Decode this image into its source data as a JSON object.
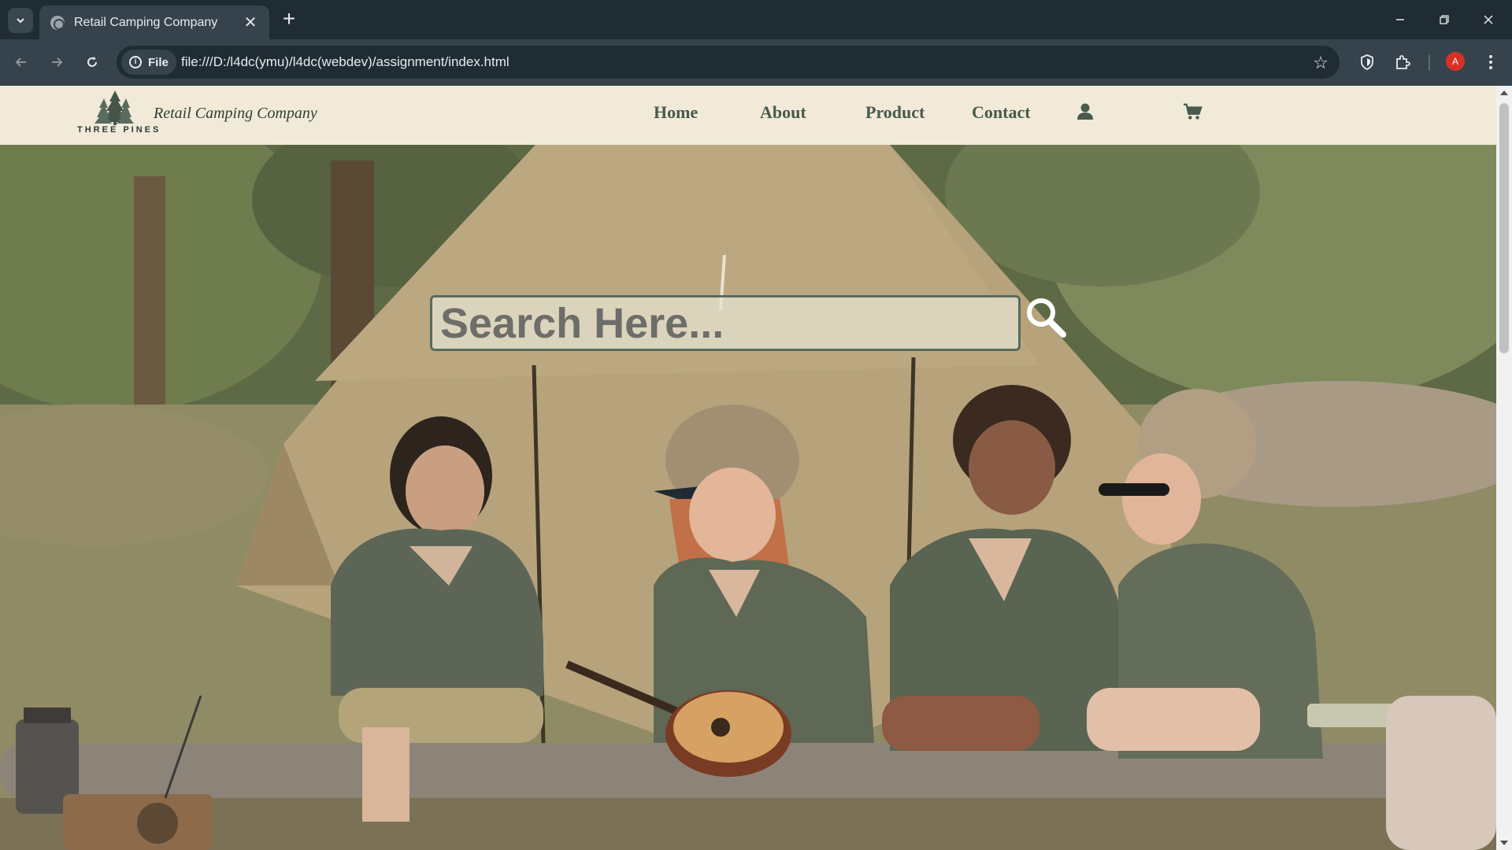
{
  "browser": {
    "tab_title": "Retail Camping Company",
    "url": "file:///D:/l4dc(ymu)/l4dc(webdev)/assignment/index.html",
    "file_chip": "File",
    "profile_initial": "A"
  },
  "site": {
    "logo_text": "THREE PINES",
    "brand": "Retail Camping Company",
    "nav": {
      "home": "Home",
      "about": "About",
      "product": "Product",
      "contact": "Contact"
    },
    "search": {
      "placeholder": "Search Here..."
    }
  },
  "colors": {
    "header_bg": "#f1ead9",
    "nav_text": "#475a4d",
    "chrome_dark": "#202c34",
    "chrome_toolbar": "#36434d"
  },
  "icons": [
    "chevron-down-icon",
    "globe-icon",
    "close-icon",
    "plus-icon",
    "minimize-icon",
    "restore-icon",
    "back-icon",
    "forward-icon",
    "reload-icon",
    "info-icon",
    "star-icon",
    "shield-icon",
    "extensions-icon",
    "menu-icon",
    "user-icon",
    "cart-icon",
    "search-icon"
  ]
}
